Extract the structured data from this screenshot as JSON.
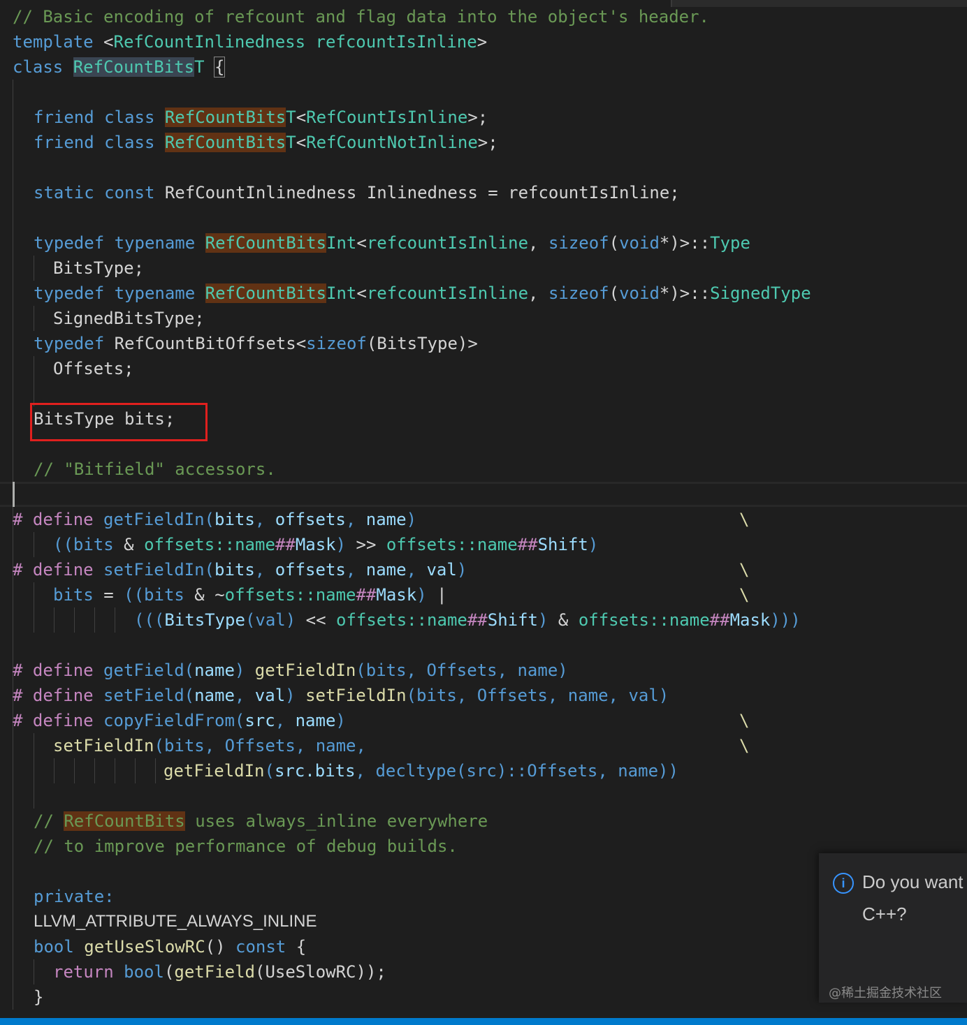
{
  "code": {
    "l1": "// Basic encoding of refcount and flag data into the object's header.",
    "l2": {
      "kw": "template",
      "lt": " <",
      "ty1": "RefCountInlinedness",
      "sp": " ",
      "vr": "refcountIsInline",
      "gt": ">"
    },
    "l3": {
      "kw": "class",
      "sp": " ",
      "cls": "RefCountBits",
      "clsT": "T",
      "sp2": " ",
      "br": "{"
    },
    "l4": {
      "kw": "friend class",
      "sp": " ",
      "hl": "RefCountBits",
      "t": "T",
      "lt": "<",
      "arg": "RefCountIsInline",
      "end": ">;"
    },
    "l5": {
      "kw": "friend class",
      "sp": " ",
      "hl": "RefCountBits",
      "t": "T",
      "lt": "<",
      "arg": "RefCountNotInline",
      "end": ">;"
    },
    "l6": {
      "kw": "static const",
      "rest": " RefCountInlinedness Inlinedness = refcountIsInline;"
    },
    "l7": {
      "kw": "typedef typename",
      "sp": " ",
      "hl": "RefCountBits",
      "int": "Int",
      "lt": "<",
      "vr": "refcountIsInline",
      "comma": ", ",
      "sz": "sizeof",
      "p1": "(",
      "vd": "void",
      "star": "*",
      "p2": ")",
      "gt": ">::",
      "ty": "Type"
    },
    "l8": "BitsType;",
    "l9": {
      "kw": "typedef typename",
      "sp": " ",
      "hl": "RefCountBits",
      "int": "Int",
      "lt": "<",
      "vr": "refcountIsInline",
      "comma": ", ",
      "sz": "sizeof",
      "p1": "(",
      "vd": "void",
      "star": "*",
      "p2": ")",
      "gt": ">::",
      "ty": "SignedType"
    },
    "l10": "SignedBitsType;",
    "l11": {
      "kw": "typedef",
      "mid": " RefCountBitOffsets<",
      "sz": "sizeof",
      "rest": "(BitsType)>"
    },
    "l12": "Offsets;",
    "l13": "BitsType bits;",
    "l14": "// \"Bitfield\" accessors.",
    "l15": {
      "hash": "# define",
      "sp": " ",
      "fn": "getFieldIn",
      "p": "(",
      "a1": "bits",
      "c1": ", ",
      "a2": "offsets",
      "c2": ", ",
      "a3": "name",
      "pe": ")",
      "bs": "\\"
    },
    "l16": {
      "pp": "((bits",
      "amp": " & ",
      "ns": "offsets::name",
      "hh": "##",
      "m": "Mask",
      "cl": ")",
      "shr": " >> ",
      "ns2": "offsets::name",
      "hh2": "##",
      "s": "Shift",
      "cl2": ")"
    },
    "l17": {
      "hash": "# define",
      "sp": " ",
      "fn": "setFieldIn",
      "p": "(",
      "a1": "bits",
      "c1": ", ",
      "a2": "offsets",
      "c2": ", ",
      "a3": "name",
      "c3": ", ",
      "a4": "val",
      "pe": ")",
      "bs": "\\"
    },
    "l18": {
      "b": "bits",
      "eq": " = ",
      "pp": "((bits",
      "amp": " & ~",
      "ns": "offsets::name",
      "hh": "##",
      "m": "Mask",
      "cl": ")",
      "or": " |",
      "bs": "\\"
    },
    "l19": {
      "pp": "(((",
      "t": "BitsType",
      "v": "(val)",
      "shl": " << ",
      "ns": "offsets::name",
      "hh": "##",
      "s": "Shift",
      "cl": ")",
      "amp": " & ",
      "ns2": "offsets::name",
      "hh2": "##",
      "m": "Mask",
      "end": ")))"
    },
    "l20": {
      "hash": "# define",
      "sp": " ",
      "fn": "getField",
      "p": "(",
      "a": "name",
      "pe": ")",
      "sp2": " ",
      "call": "getFieldIn",
      "args": "(bits, Offsets, name)"
    },
    "l21": {
      "hash": "# define",
      "sp": " ",
      "fn": "setField",
      "p": "(",
      "a": "name",
      "c": ", ",
      "a2": "val",
      "pe": ")",
      "sp2": " ",
      "call": "setFieldIn",
      "args": "(bits, Offsets, name, val)"
    },
    "l22": {
      "hash": "# define",
      "sp": " ",
      "fn": "copyFieldFrom",
      "p": "(",
      "a": "src",
      "c": ", ",
      "a2": "name",
      "pe": ")",
      "bs": "\\"
    },
    "l23": {
      "call": "setFieldIn",
      "args": "(bits, Offsets, name,",
      "bs": "\\"
    },
    "l24": {
      "call": "getFieldIn",
      "p": "(",
      "a": "src.bits",
      "c": ", ",
      "kw": "decltype",
      "rest": "(src)::Offsets, name))"
    },
    "l25": {
      "pre": "// ",
      "hl": "RefCountBits",
      "post": " uses always_inline everywhere"
    },
    "l26": "// to improve performance of debug builds.",
    "l27": "private:",
    "l28": "LLVM_ATTRIBUTE_ALWAYS_INLINE",
    "l29": {
      "kw": "bool",
      "sp": " ",
      "fn": "getUseSlowRC",
      "p": "()",
      "sp2": " ",
      "kw2": "const",
      "br": " {"
    },
    "l30": {
      "kw": "return",
      "sp": " ",
      "kw2": "bool",
      "p": "(",
      "fn": "getField",
      "rest": "(UseSlowRC));"
    },
    "l31": "}"
  },
  "notification": {
    "icon": "info-icon",
    "line1": "Do you want",
    "line2": "C++?"
  },
  "watermark": "@稀土掘金技术社区",
  "colors": {
    "background": "#1e1e1e",
    "comment": "#6a9955",
    "keyword": "#569cd6",
    "type": "#4ec9b0",
    "function": "#dcdcaa",
    "variable": "#9cdcfe",
    "highlight": "#613214",
    "annotation_box": "#e0201e",
    "statusbar": "#007acc"
  }
}
